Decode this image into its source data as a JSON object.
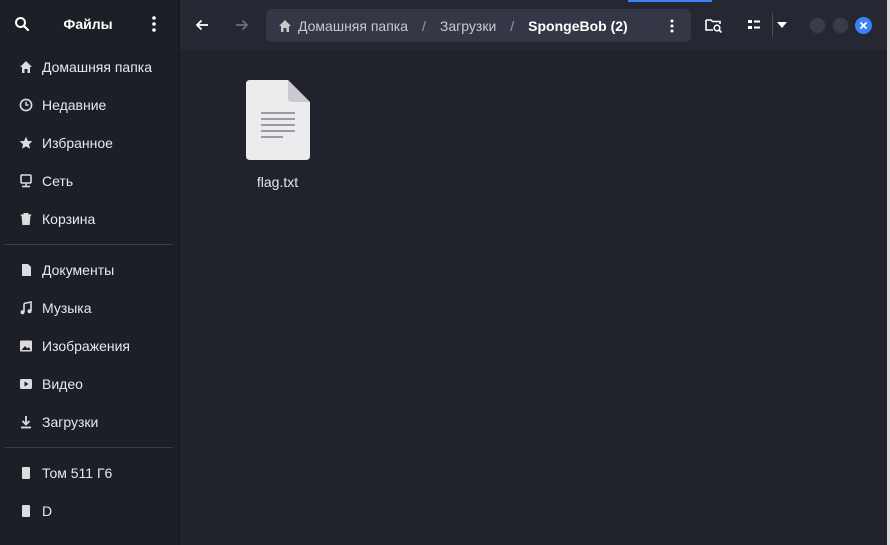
{
  "app": {
    "title": "Файлы"
  },
  "sidebar": {
    "places": [
      {
        "label": "Домашняя папка",
        "icon": "home-icon"
      },
      {
        "label": "Недавние",
        "icon": "clock-icon"
      },
      {
        "label": "Избранное",
        "icon": "star-icon"
      },
      {
        "label": "Сеть",
        "icon": "network-icon"
      },
      {
        "label": "Корзина",
        "icon": "trash-icon"
      }
    ],
    "folders": [
      {
        "label": "Документы",
        "icon": "document-icon"
      },
      {
        "label": "Музыка",
        "icon": "music-icon"
      },
      {
        "label": "Изображения",
        "icon": "image-icon"
      },
      {
        "label": "Видео",
        "icon": "video-icon"
      },
      {
        "label": "Загрузки",
        "icon": "download-icon"
      }
    ],
    "drives": [
      {
        "label": "Том 511 Г6",
        "icon": "drive-icon"
      },
      {
        "label": "D",
        "icon": "drive-icon"
      }
    ]
  },
  "pathbar": {
    "home": "Домашняя папка",
    "downloads": "Загрузки",
    "current": "SpongeBob (2)",
    "separator": "/"
  },
  "files": [
    {
      "name": "flag.txt",
      "icon": "text-file-icon"
    }
  ],
  "colors": {
    "close": "#3b82f6",
    "window_button": "#3a3c48",
    "accent": "#3b82f6"
  }
}
